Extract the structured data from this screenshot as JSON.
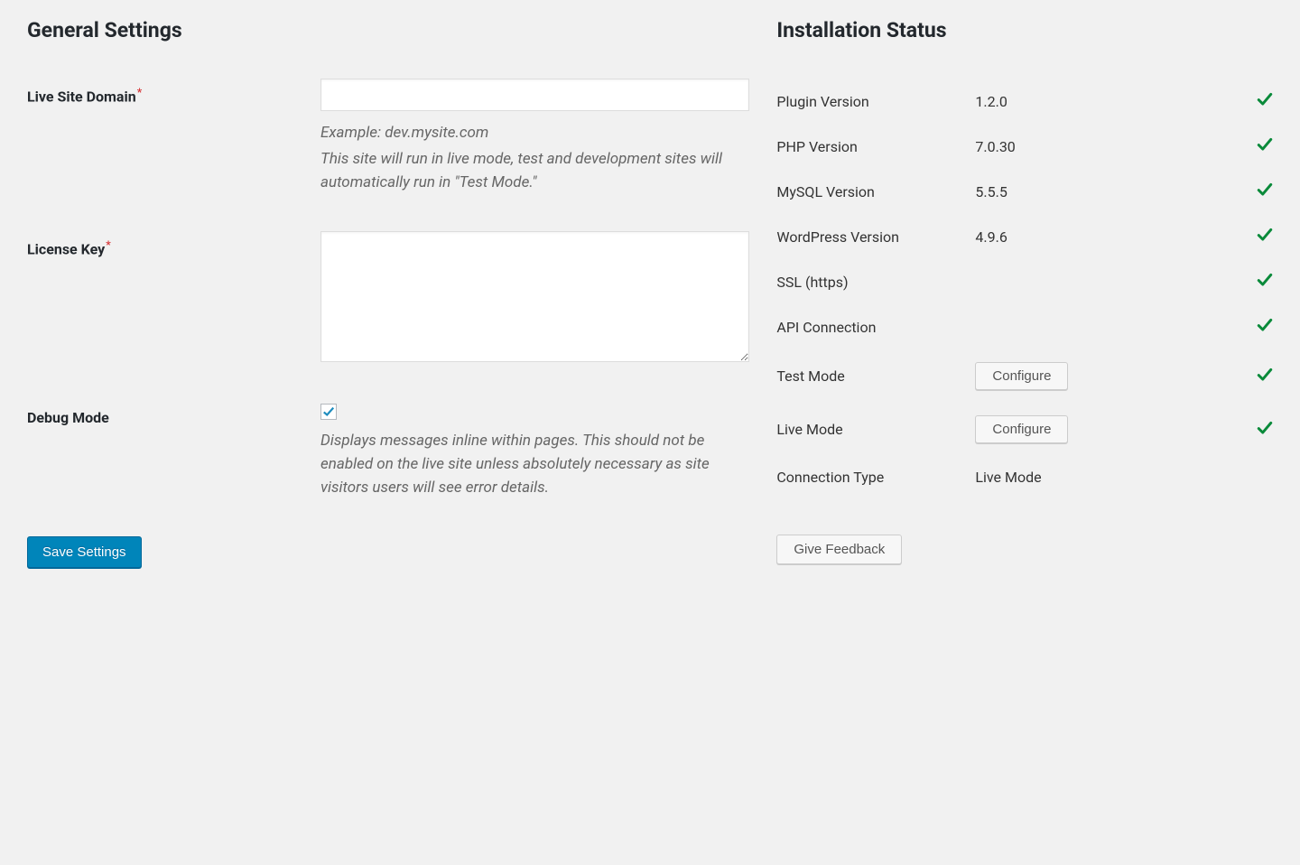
{
  "general": {
    "title": "General Settings",
    "live_domain": {
      "label": "Live Site Domain",
      "value": "",
      "example": "Example: dev.mysite.com",
      "help": "This site will run in live mode, test and development sites will automatically run in \"Test Mode.\""
    },
    "license_key": {
      "label": "License Key",
      "value": ""
    },
    "debug_mode": {
      "label": "Debug Mode",
      "checked": true,
      "help": "Displays messages inline within pages. This should not be enabled on the live site unless absolutely necessary as site visitors users will see error details."
    },
    "save_label": "Save Settings"
  },
  "status": {
    "title": "Installation Status",
    "rows": [
      {
        "label": "Plugin Version",
        "value": "1.2.0",
        "ok": true
      },
      {
        "label": "PHP Version",
        "value": "7.0.30",
        "ok": true
      },
      {
        "label": "MySQL Version",
        "value": "5.5.5",
        "ok": true
      },
      {
        "label": "WordPress Version",
        "value": "4.9.6",
        "ok": true
      },
      {
        "label": "SSL (https)",
        "value": "",
        "ok": true
      },
      {
        "label": "API Connection",
        "value": "",
        "ok": true
      },
      {
        "label": "Test Mode",
        "button": "Configure",
        "ok": true
      },
      {
        "label": "Live Mode",
        "button": "Configure",
        "ok": true
      },
      {
        "label": "Connection Type",
        "value": "Live Mode",
        "ok": false
      }
    ],
    "feedback_label": "Give Feedback"
  }
}
